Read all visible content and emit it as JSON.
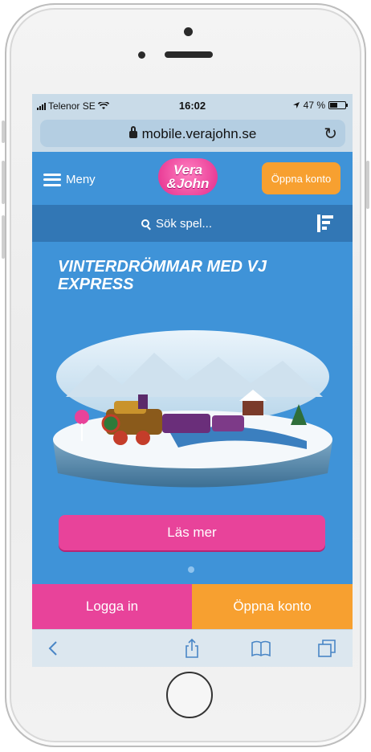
{
  "status_bar": {
    "carrier": "Telenor SE",
    "time": "16:02",
    "battery": "47 %"
  },
  "browser": {
    "url": "mobile.verajohn.se"
  },
  "header": {
    "menu_label": "Meny",
    "logo_line1": "Vera",
    "logo_line2": "&John",
    "open_account": "Öppna konto"
  },
  "search": {
    "placeholder": "Sök spel..."
  },
  "promo": {
    "title": "VINTERDRÖMMAR MED VJ EXPRESS",
    "cta": "Läs mer"
  },
  "actions": {
    "login": "Logga in",
    "open_account": "Öppna konto"
  },
  "toolbar": {
    "icons": [
      "back-icon",
      "share-icon",
      "bookmarks-icon",
      "tabs-icon"
    ]
  },
  "colors": {
    "page_blue": "#3f93d8",
    "pink": "#e8439a",
    "orange": "#f7a030"
  }
}
